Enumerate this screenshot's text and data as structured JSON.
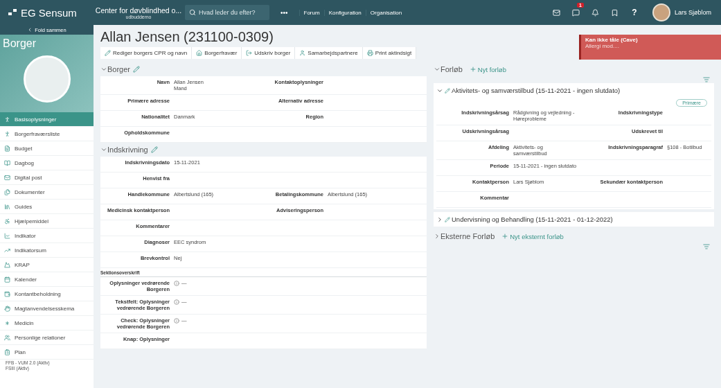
{
  "topbar": {
    "logo": "EG Sensum",
    "org": "Center for døvblindhed o...",
    "org_sub": "udbuddemo",
    "search": {
      "placeholder": "Hvad leder du efter?"
    },
    "more": "•••",
    "links": [
      "Forum",
      "Konfiguration",
      "Organisation"
    ],
    "chat_badge": "1",
    "help": "?",
    "user": "Lars Sjøblom"
  },
  "sidebar": {
    "collapse": "Fold sammen",
    "title": "Borger",
    "items": [
      {
        "label": "Basisoplysninger",
        "selected": true
      },
      {
        "label": "Borgerfraværsliste",
        "selected": false
      },
      {
        "label": "Budget",
        "selected": false
      },
      {
        "label": "Dagbog",
        "selected": false
      },
      {
        "label": "Digital post",
        "selected": false
      },
      {
        "label": "Dokumenter",
        "selected": false
      },
      {
        "label": "Guides",
        "selected": false
      },
      {
        "label": "Hjælpemiddel",
        "selected": false
      },
      {
        "label": "Indikator",
        "selected": false
      },
      {
        "label": "Indikatorsum",
        "selected": false
      },
      {
        "label": "KRAP",
        "selected": false
      },
      {
        "label": "Kalender",
        "selected": false
      },
      {
        "label": "Kontantbeholdning",
        "selected": false
      },
      {
        "label": "Magtanvendelsesskema",
        "selected": false
      },
      {
        "label": "Medicin",
        "selected": false
      },
      {
        "label": "Personlige relationer",
        "selected": false
      },
      {
        "label": "Plan",
        "selected": false,
        "children": [
          "FFB - VUM 2.0 (Aktiv)",
          "FSIII (Aktiv)"
        ]
      }
    ]
  },
  "title": "Allan Jensen (231100-0309)",
  "actions": [
    "Rediger borgers CPR og navn",
    "Borgerfravær",
    "Udskriv borger",
    "Samarbejdspartnere",
    "Print aktindsigt"
  ],
  "alert": {
    "title": "Kan ikke tåle (Cave)",
    "text": "Allergi mod...."
  },
  "sections": [
    {
      "title": "Borger",
      "expanded": true,
      "rows": [
        [
          {
            "label": "Navn",
            "value": [
              "Allan Jensen",
              "Mand"
            ]
          },
          {
            "label": "Kontaktoplysninger"
          }
        ],
        [
          {
            "label": "Primære adresse"
          },
          {
            "label": "Alternativ adresse"
          }
        ],
        [
          {
            "label": "Nationalitet",
            "value": [
              "Danmark"
            ]
          },
          {
            "label": "Region"
          }
        ],
        [
          {
            "label": "Opholdskommune"
          }
        ]
      ]
    },
    {
      "title": "Indskrivning",
      "expanded": true,
      "rows": [
        [
          {
            "label": "Indskrivningsdato",
            "value": [
              "15-11-2021"
            ]
          }
        ],
        [
          {
            "label": "Henvist fra"
          }
        ],
        [
          {
            "label": "Handlekommune",
            "value": [
              "Albertslund (165)"
            ]
          },
          {
            "label": "Betalingskommune",
            "value": [
              "Albertslund (165)"
            ]
          }
        ],
        [
          {
            "label": "Medicinsk kontaktperson"
          },
          {
            "label": "Adviseringsperson"
          }
        ],
        [
          {
            "label": "Kommentarer"
          }
        ],
        [
          {
            "label": "Diagnoser",
            "value": [
              "EEC syndrom"
            ]
          }
        ],
        [
          {
            "label": "Brevkontrol",
            "value": [
              "Nej"
            ]
          }
        ]
      ]
    }
  ],
  "subsection": {
    "title": "Sektionsoverskrift",
    "rows": [
      {
        "label": "Oplysninger vedrørende Borgeren",
        "value": "—"
      },
      {
        "label": "Tekstfelt: Oplysninger vedrørende Borgeren",
        "value": "—"
      },
      {
        "label": "Check: Oplysninger vedrørende Borgeren",
        "value": "—"
      },
      {
        "label": "Knap: Oplysninger"
      }
    ]
  },
  "forloeb": {
    "title": "Forløb",
    "expanded": true,
    "add": "Nyt forløb",
    "items": [
      {
        "title": "Aktivitets- og samværstilbud (15-11-2021 - ingen slutdato)",
        "expanded": true,
        "badge": "Primære",
        "rows": [
          [
            {
              "label": "Indskrivningsårsag",
              "value": [
                "Rådgivning og vejledning -",
                "Høreprobleme"
              ]
            },
            {
              "label": "Indskrivningstype"
            }
          ],
          [
            {
              "label": "Udskrivningsårsag"
            },
            {
              "label": "Udskrevet til"
            }
          ],
          [
            {
              "label": "Afdeling",
              "value": [
                "Aktivitets- og",
                "samværstilbud"
              ]
            },
            {
              "label": "Indskrivningsparagraf",
              "value": [
                "§108 - Botilbud"
              ]
            }
          ],
          [
            {
              "label": "Periode",
              "value": [
                "15-11-2021 - ingen slutdato"
              ]
            }
          ],
          [
            {
              "label": "Kontaktperson",
              "value": [
                "Lars Sjøblom"
              ]
            },
            {
              "label": "Sekundær kontaktperson"
            }
          ],
          [
            {
              "label": "Kommentar"
            }
          ]
        ]
      },
      {
        "title": "Undervisning og Behandling (15-11-2021 - 01-12-2022)",
        "expanded": false
      }
    ]
  },
  "eksterne": {
    "title": "Eksterne Forløb",
    "expanded": false,
    "add": "Nyt eksternt forløb"
  }
}
